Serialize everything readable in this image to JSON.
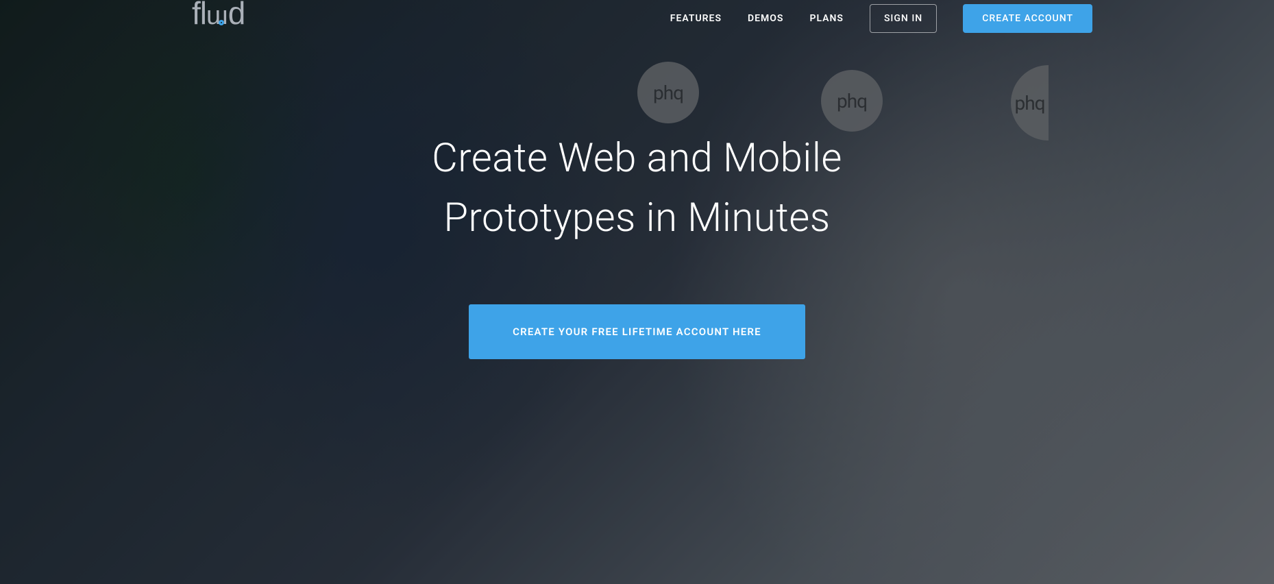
{
  "logo": {
    "text": "fluid"
  },
  "nav": {
    "links": [
      {
        "label": "FEATURES"
      },
      {
        "label": "DEMOS"
      },
      {
        "label": "PLANS"
      }
    ],
    "sign_in_label": "SIGN IN",
    "create_account_label": "CREATE ACCOUNT"
  },
  "hero": {
    "title_line1": "Create Web and Mobile",
    "title_line2": "Prototypes in Minutes",
    "cta_label": "CREATE YOUR FREE LIFETIME ACCOUNT HERE"
  },
  "bg_badges": {
    "text": "phq"
  },
  "colors": {
    "accent": "#3ea3e8",
    "logo_gray": "#aab0b8"
  }
}
